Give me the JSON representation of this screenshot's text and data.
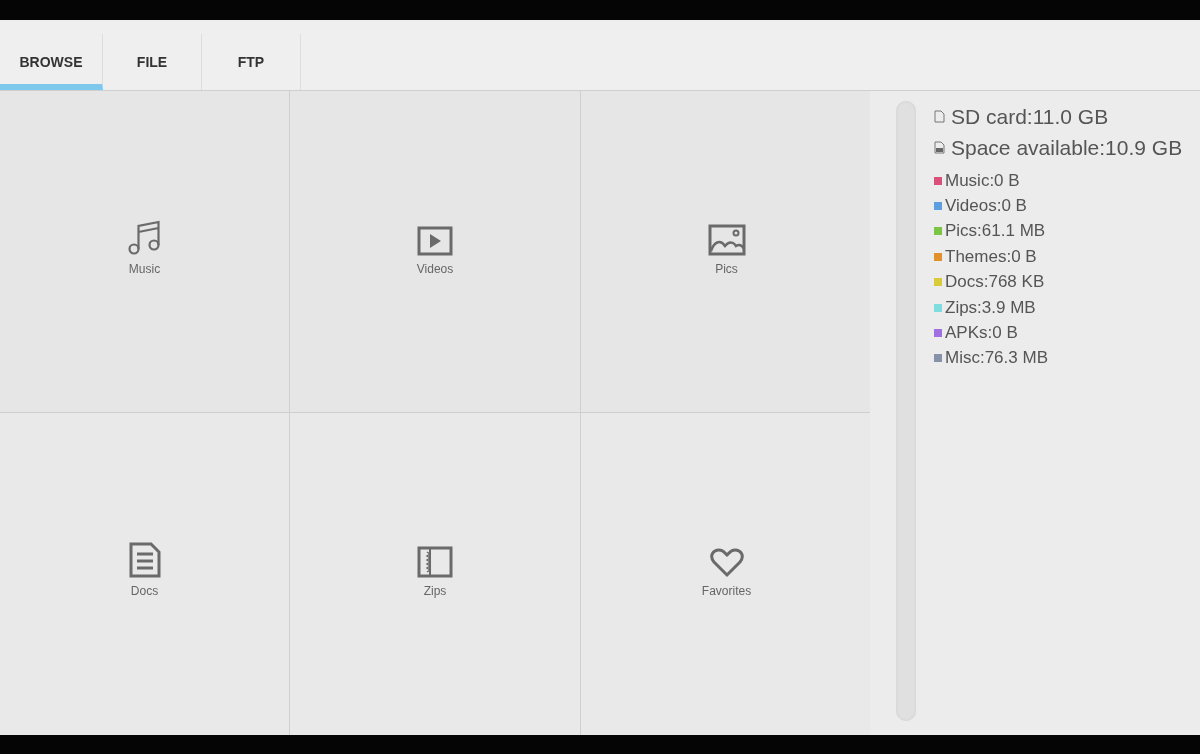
{
  "tabs": [
    {
      "label": "BROWSE",
      "selected": true
    },
    {
      "label": "FILE",
      "selected": false
    },
    {
      "label": "FTP",
      "selected": false
    }
  ],
  "tiles": [
    {
      "kind": "music",
      "label": "Music"
    },
    {
      "kind": "video",
      "label": "Videos"
    },
    {
      "kind": "picture",
      "label": "Pics"
    },
    {
      "kind": "document",
      "label": "Docs"
    },
    {
      "kind": "archive",
      "label": "Zips"
    },
    {
      "kind": "heart",
      "label": "Favorites"
    }
  ],
  "storage": {
    "total": "SD card:11.0 GB",
    "available": "Space available:10.9 GB",
    "categories": [
      {
        "label": "Music:0 B",
        "color": "#d9507a"
      },
      {
        "label": "Videos:0 B",
        "color": "#5c9fe0"
      },
      {
        "label": "Pics:61.1 MB",
        "color": "#7cc444"
      },
      {
        "label": "Themes:0 B",
        "color": "#e0902c"
      },
      {
        "label": "Docs:768 KB",
        "color": "#d8cc3a"
      },
      {
        "label": "Zips:3.9 MB",
        "color": "#7fdde0"
      },
      {
        "label": "APKs:0 B",
        "color": "#a070e0"
      },
      {
        "label": "Misc:76.3 MB",
        "color": "#8890aa"
      }
    ]
  }
}
